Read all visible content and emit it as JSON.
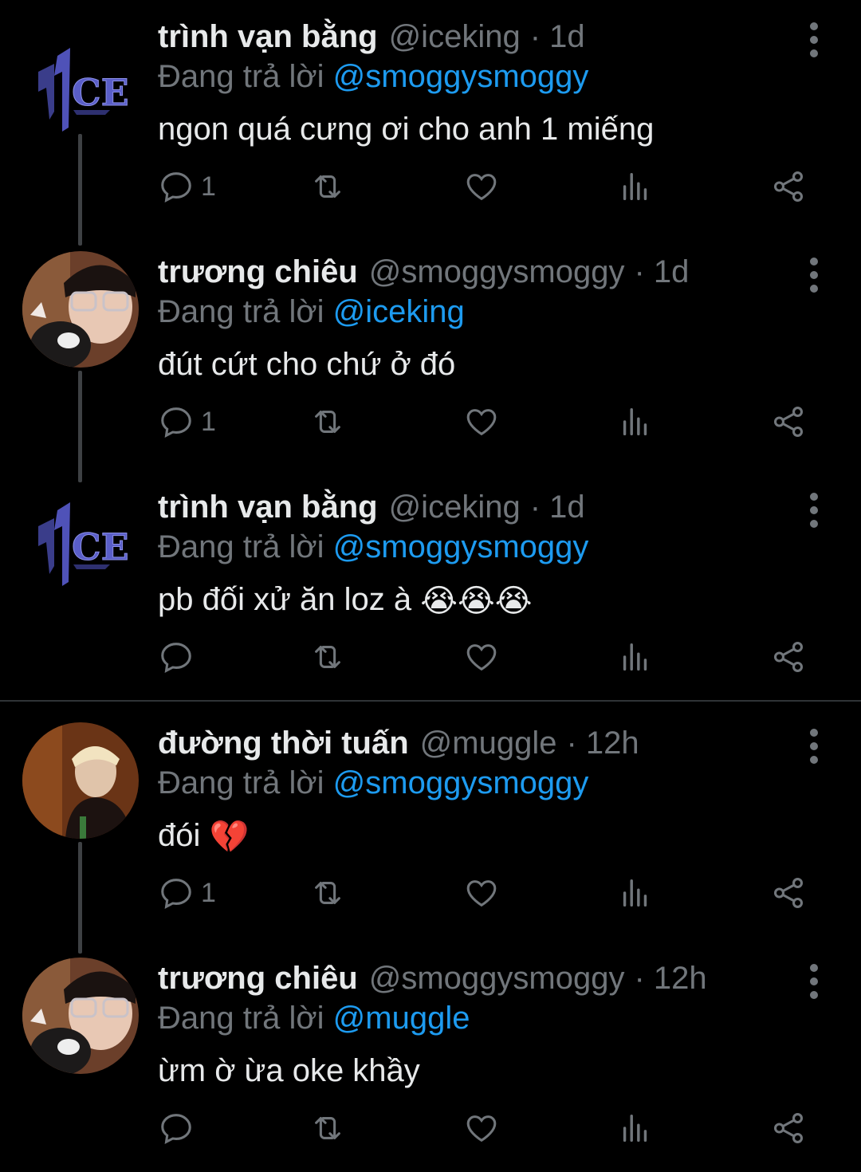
{
  "reply_prefix": "Đang trả lời",
  "tweets": [
    {
      "name": "trình vạn bằng",
      "handle": "@iceking",
      "time": "· 1d",
      "reply_to": "@smoggysmoggy",
      "text": "ngon quá cưng ơi cho anh 1 miếng",
      "reply_count": "1",
      "avatar": "ice-logo"
    },
    {
      "name": "trương chiêu",
      "handle": "@smoggysmoggy",
      "time": "· 1d",
      "reply_to": "@iceking",
      "text": "đút cứt cho chứ ở đó",
      "reply_count": "1",
      "avatar": "person-glasses"
    },
    {
      "name": "trình vạn bằng",
      "handle": "@iceking",
      "time": "· 1d",
      "reply_to": "@smoggysmoggy",
      "text": "pb đối xử ăn loz à",
      "emoji": "😭😭😭",
      "reply_count": "",
      "avatar": "ice-logo"
    },
    {
      "name": "đường thời tuấn",
      "handle": "@muggle",
      "time": "· 12h",
      "reply_to": "@smoggysmoggy",
      "text": "đói",
      "emoji": "💔",
      "reply_count": "1",
      "avatar": "person-blond"
    },
    {
      "name": "trương chiêu",
      "handle": "@smoggysmoggy",
      "time": "· 12h",
      "reply_to": "@muggle",
      "text": "ừm ờ ừa oke khầy",
      "reply_count": "",
      "avatar": "person-glasses"
    }
  ],
  "colors": {
    "background": "#000000",
    "text": "#e7e9ea",
    "muted": "#71767b",
    "link": "#1d9bf0"
  }
}
